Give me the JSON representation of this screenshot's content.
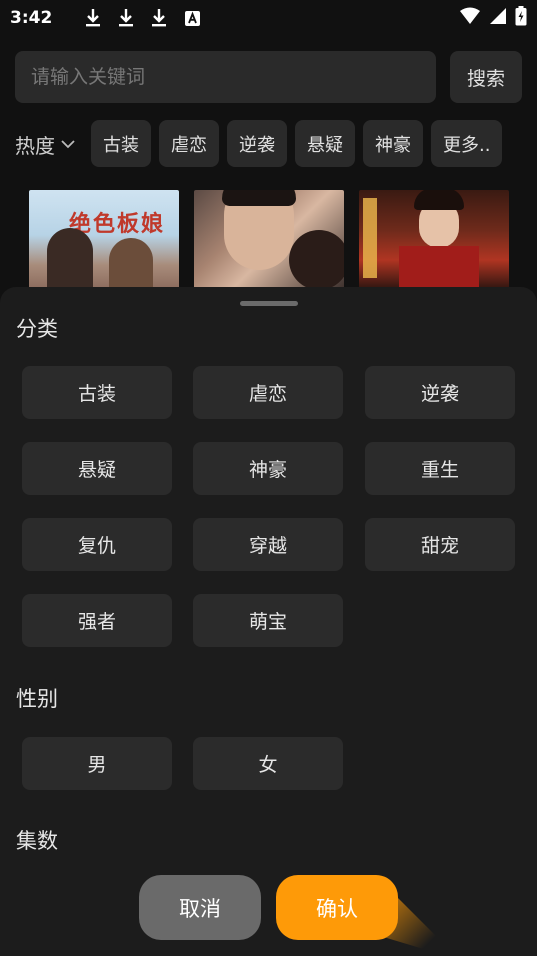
{
  "status_bar": {
    "time": "3:42",
    "icons": [
      "download-icon",
      "download-icon",
      "download-icon",
      "accessibility-a-icon",
      "wifi-icon",
      "signal-icon",
      "battery-icon"
    ]
  },
  "search": {
    "placeholder": "请输入关键词",
    "button_label": "搜索"
  },
  "filter_bar": {
    "sort_label": "热度",
    "chips": [
      "古装",
      "虐恋",
      "逆袭",
      "悬疑",
      "神豪",
      "更多.."
    ]
  },
  "posters": {
    "p1_title": "绝色板娘"
  },
  "sheet": {
    "category_title": "分类",
    "categories": [
      "古装",
      "虐恋",
      "逆袭",
      "悬疑",
      "神豪",
      "重生",
      "复仇",
      "穿越",
      "甜宠",
      "强者",
      "萌宝"
    ],
    "gender_title": "性别",
    "genders": [
      "男",
      "女"
    ],
    "episodes_title": "集数"
  },
  "actions": {
    "cancel_label": "取消",
    "confirm_label": "确认"
  },
  "colors": {
    "accent": "#fe9a08",
    "background": "#111111",
    "sheet": "#1c1c1c",
    "chip": "#2a2a2a"
  }
}
